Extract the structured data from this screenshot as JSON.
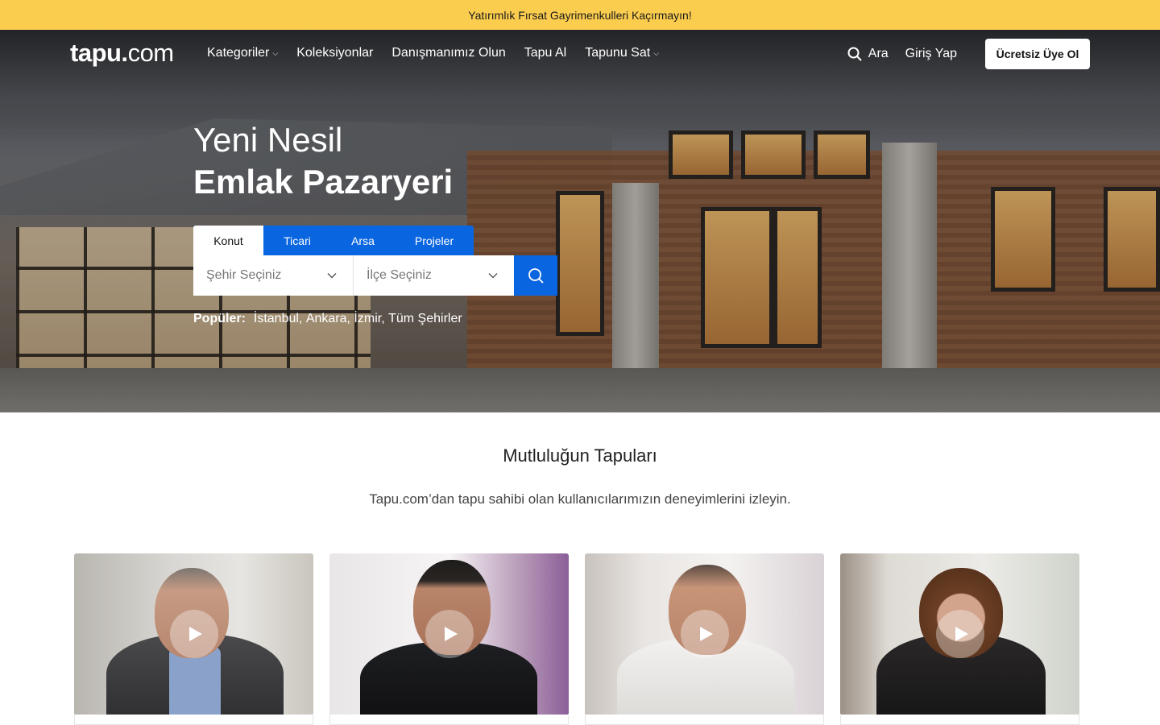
{
  "announcement": {
    "text": "Yatırımlık Fırsat Gayrimenkulleri Kaçırmayın!"
  },
  "header": {
    "logo_bold": "tapu.",
    "logo_light": "com",
    "nav": [
      {
        "label": "Kategoriler",
        "has_dropdown": true
      },
      {
        "label": "Koleksiyonlar",
        "has_dropdown": false
      },
      {
        "label": "Danışmanımız Olun",
        "has_dropdown": false
      },
      {
        "label": "Tapu Al",
        "has_dropdown": false
      },
      {
        "label": "Tapunu Sat",
        "has_dropdown": true
      }
    ],
    "search_label": "Ara",
    "login_label": "Giriş Yap",
    "signup_label": "Ücretsiz Üye Ol"
  },
  "hero": {
    "title_line1": "Yeni Nesil",
    "title_line2": "Emlak Pazaryeri",
    "tabs": [
      {
        "label": "Konut",
        "active": true
      },
      {
        "label": "Ticari",
        "active": false
      },
      {
        "label": "Arsa",
        "active": false
      },
      {
        "label": "Projeler",
        "active": false
      }
    ],
    "city_select": {
      "placeholder": "Şehir Seçiniz"
    },
    "district_select": {
      "placeholder": "İlçe Seçiniz"
    },
    "popular_label": "Popüler:",
    "popular_links": [
      "İstanbul,",
      "Ankara,",
      "İzmir,",
      "Tüm Şehirler"
    ]
  },
  "testimonials": {
    "title": "Mutluluğun Tapuları",
    "subtitle": "Tapu.com’dan tapu sahibi olan kullanıcılarımızın deneyimlerini izleyin.",
    "videos": [
      {
        "id": 1
      },
      {
        "id": 2
      },
      {
        "id": 3
      },
      {
        "id": 4
      }
    ]
  },
  "colors": {
    "announcement_bg": "#fbcd4f",
    "brand_blue": "#0a66e0",
    "text_dark": "#222222"
  }
}
